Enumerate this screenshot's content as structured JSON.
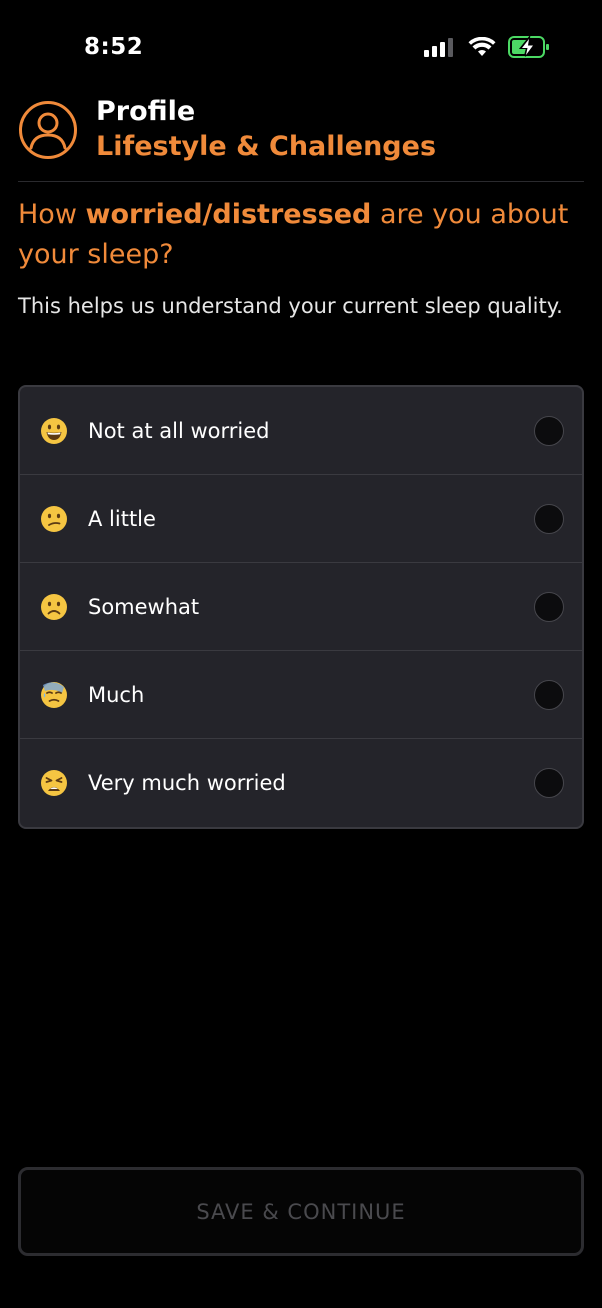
{
  "status": {
    "time": "8:52"
  },
  "header": {
    "title": "Profile",
    "subtitle": "Lifestyle & Challenges"
  },
  "question": {
    "prefix": "How ",
    "emphasis": "worried/distressed",
    "suffix": " are you about your sleep?",
    "helper": "This helps us understand your current sleep quality."
  },
  "options": [
    {
      "label": "Not at all worried",
      "icon": "grinning-face-icon"
    },
    {
      "label": "A little",
      "icon": "confused-face-icon"
    },
    {
      "label": "Somewhat",
      "icon": "frowning-face-icon"
    },
    {
      "label": "Much",
      "icon": "downcast-sweat-face-icon"
    },
    {
      "label": "Very much worried",
      "icon": "weary-face-icon"
    }
  ],
  "footer": {
    "save_label": "SAVE & CONTINUE"
  },
  "colors": {
    "accent": "#f08a3a",
    "background": "#000000",
    "card": "#24242a",
    "battery": "#4cd964"
  }
}
